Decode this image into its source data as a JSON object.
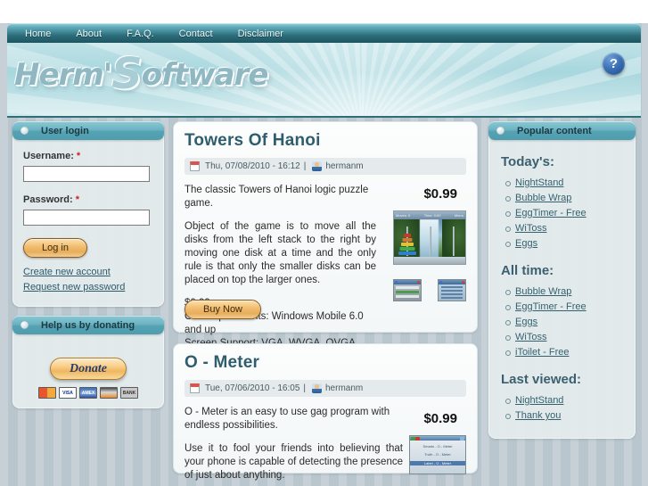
{
  "site": {
    "logo_text_1": "Herm'",
    "logo_text_s": "S",
    "logo_text_2": "oftware",
    "help_icon_label": "?"
  },
  "nav": {
    "items": [
      {
        "label": "Home"
      },
      {
        "label": "About"
      },
      {
        "label": "F.A.Q."
      },
      {
        "label": "Contact"
      },
      {
        "label": "Disclaimer"
      }
    ]
  },
  "sidebar_left": {
    "login_block": {
      "title": "User login",
      "username_label": "Username:",
      "username_required": "*",
      "username_value": "",
      "password_label": "Password:",
      "password_required": "*",
      "password_value": "",
      "login_button": "Log in",
      "links": [
        {
          "label": "Create new account"
        },
        {
          "label": "Request new password"
        }
      ]
    },
    "donate_block": {
      "title": "Help us by donating",
      "donate_button": "Donate",
      "cards": [
        {
          "label": ""
        },
        {
          "label": "VISA"
        },
        {
          "label": "AMEX"
        },
        {
          "label": ""
        },
        {
          "label": "BANK"
        }
      ]
    }
  },
  "main": {
    "nodes": [
      {
        "title": "Towers Of Hanoi",
        "submitted_date": "Thu, 07/08/2010 - 16:12",
        "submitted_sep": "|",
        "submitted_author": "hermanm",
        "price": "$0.99",
        "intro": "The classic Towers of Hanoi logic puzzle game.",
        "description": "Object of the game is to move all the disks from the left stack to the right by moving one disk at a time and the only rule is that only the smaller disks can be placed on top the larger ones.",
        "price_line": "$0.99",
        "os_line": "OS Requirements: Windows Mobile 6.0 and up",
        "screen_line": "Screen Support: VGA, WVGA, QVGA, WQVGA",
        "buy_button": "Buy Now",
        "shot_title_left": "Moves: 0",
        "shot_title_mid": "Time: 0:00",
        "shot_title_right": "Menu"
      },
      {
        "title": "O - Meter",
        "submitted_date": "Tue, 07/06/2010 - 16:05",
        "submitted_sep": "|",
        "submitted_author": "hermanm",
        "price": "$0.99",
        "intro": "O - Meter is an easy to use gag program with endless possibilities.",
        "description": "Use it to fool your friends into believing that your phone is capable of detecting the presence of just about anything.",
        "shot_line_1": "Smarts - O - Meter",
        "shot_line_2": "Truth - O - Meter",
        "shot_line_3": "Label - O - Meter"
      }
    ]
  },
  "sidebar_right": {
    "block_title": "Popular content",
    "sections": [
      {
        "heading": "Today's:",
        "items": [
          {
            "label": "NightStand"
          },
          {
            "label": "Bubble Wrap"
          },
          {
            "label": "EggTimer - Free"
          },
          {
            "label": "WiToss"
          },
          {
            "label": "Eggs"
          }
        ]
      },
      {
        "heading": "All time:",
        "items": [
          {
            "label": "Bubble Wrap"
          },
          {
            "label": "EggTimer - Free"
          },
          {
            "label": "Eggs"
          },
          {
            "label": "WiToss"
          },
          {
            "label": "iToilet - Free"
          }
        ]
      },
      {
        "heading": "Last viewed:",
        "items": [
          {
            "label": "NightStand"
          },
          {
            "label": "Thank you"
          }
        ]
      }
    ]
  },
  "colors": {
    "nav_dark": "#1d5460",
    "banner_teal": "#a8d7de",
    "block_header": "#55a2b3",
    "title_blue": "#2f5d6e",
    "button_orange": "#f2bd70",
    "page_bg": "#b9c6cd"
  }
}
